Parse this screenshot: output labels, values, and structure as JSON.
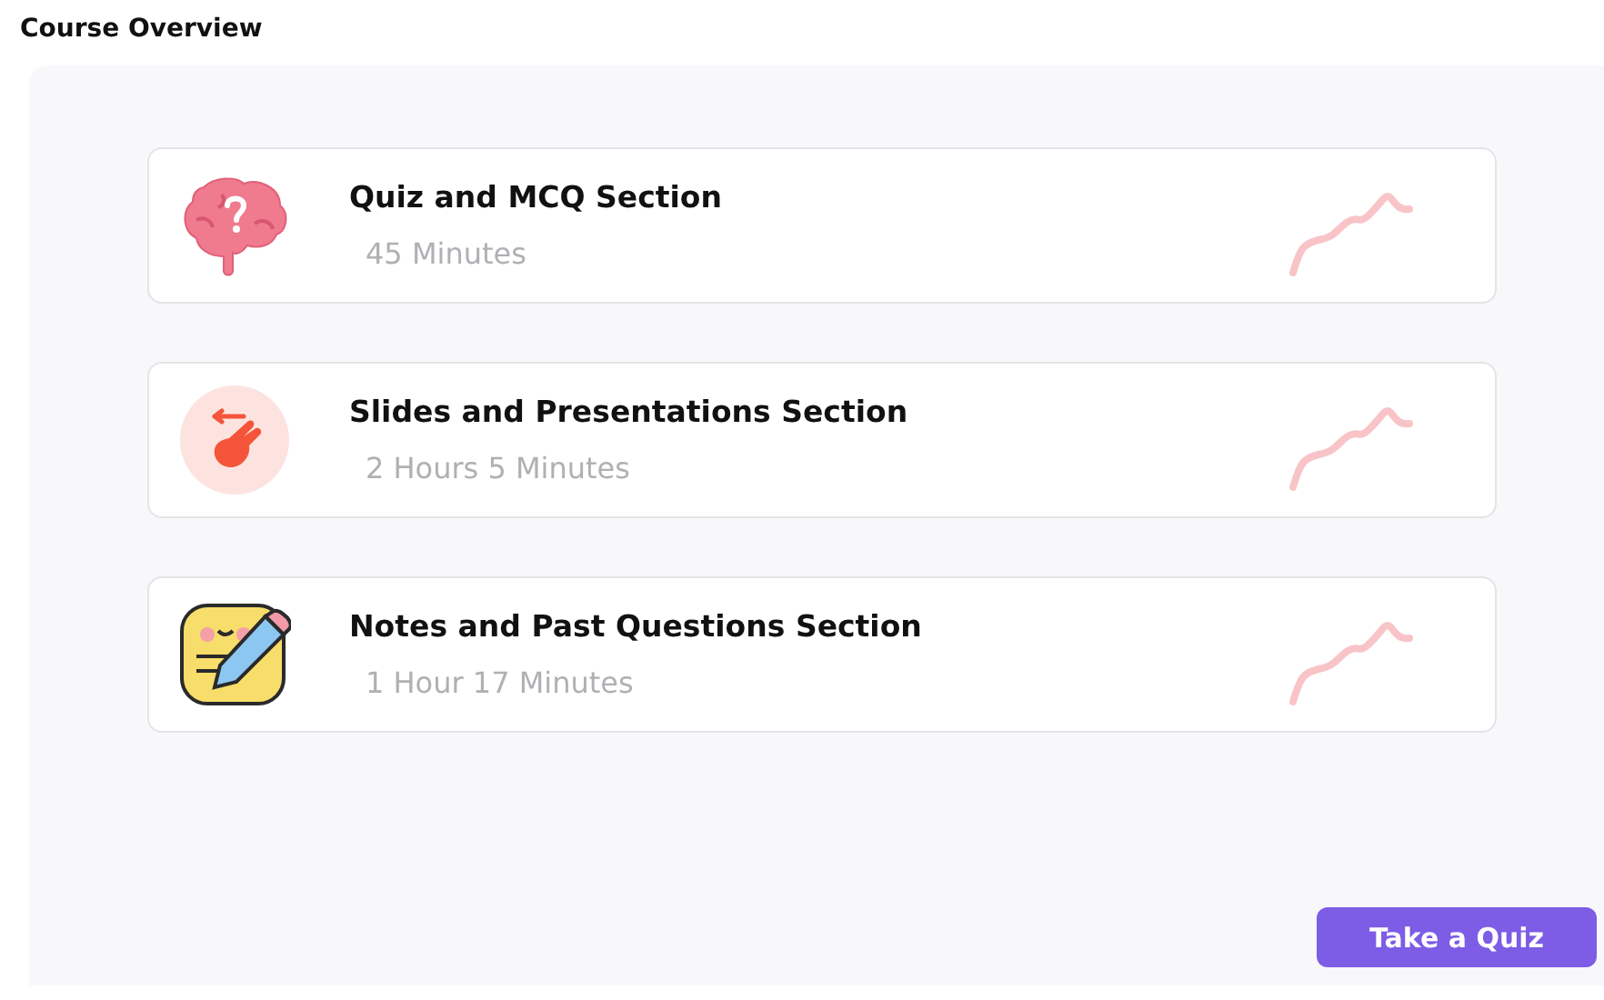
{
  "title": "Course Overview",
  "sections": [
    {
      "kind": "brain",
      "name": "Quiz and MCQ Section",
      "duration": "45 Minutes"
    },
    {
      "kind": "swipe",
      "name": "Slides and Presentations Section",
      "duration": "2 Hours 5 Minutes"
    },
    {
      "kind": "notes",
      "name": "Notes and Past Questions Section",
      "duration": "1 Hour 17 Minutes"
    }
  ],
  "button": "Take a Quiz"
}
